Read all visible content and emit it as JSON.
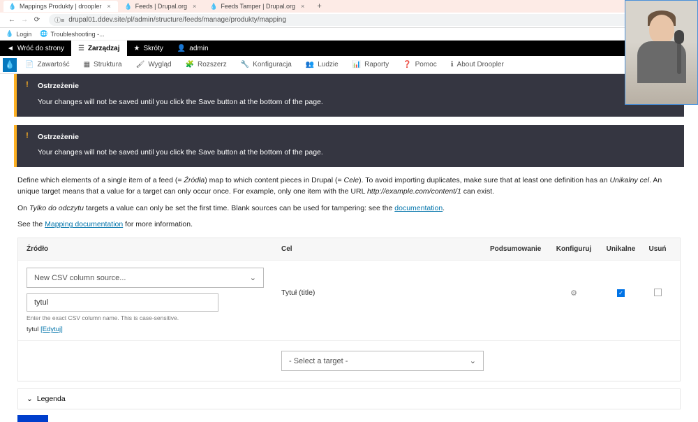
{
  "tabs": [
    {
      "label": "Mappings Produkty | droopler",
      "active": true,
      "favicon": "drupal"
    },
    {
      "label": "Feeds | Drupal.org",
      "active": false,
      "favicon": "drupal"
    },
    {
      "label": "Feeds Tamper | Drupal.org",
      "active": false,
      "favicon": "drupal"
    }
  ],
  "url": "drupal01.ddev.site/pl/admin/structure/feeds/manage/produkty/mapping",
  "bookmarks": [
    {
      "label": "Login"
    },
    {
      "label": "Troubleshooting -..."
    }
  ],
  "black_toolbar": {
    "back": "Wróć do strony",
    "manage": "Zarządzaj",
    "shortcuts": "Skróty",
    "admin": "admin"
  },
  "sub_toolbar": {
    "items": [
      "Zawartość",
      "Struktura",
      "Wygląd",
      "Rozszerz",
      "Konfiguracja",
      "Ludzie",
      "Raporty",
      "Pomoc",
      "About Droopler"
    ]
  },
  "warning": {
    "title": "Ostrzeżenie",
    "message": "Your changes will not be saved until you click the Save button at the bottom of the page."
  },
  "description": {
    "line1_prefix": "Define which elements of a single item of a feed (= ",
    "src_em": "Źródła",
    "line1_mid": ") map to which content pieces in Drupal (= ",
    "tgt_em": "Cele",
    "line1_mid2": "). To avoid importing duplicates, make sure that at least one definition has an ",
    "unique_em": "Unikalny cel",
    "line1_suffix": ". An unique target means that a value for a target can only occur once. For example, only one item with the URL ",
    "url_em": "http://example.com/content/1",
    "line1_end": " can exist.",
    "line2_prefix": "On ",
    "readonly_em": "Tylko do odczytu",
    "line2_mid": " targets a value can only be set the first time. Blank sources can be used for tampering: see the ",
    "doc_link": "documentation",
    "line2_end": ".",
    "line3_prefix": "See the ",
    "mapping_link": "Mapping documentation",
    "line3_suffix": " for more information."
  },
  "table": {
    "headers": {
      "source": "Źródło",
      "target": "Cel",
      "summary": "Podsumowanie",
      "configure": "Konfiguruj",
      "unique": "Unikalne",
      "delete": "Usuń"
    },
    "row": {
      "select_placeholder": "New CSV column source...",
      "input_value": "tytul",
      "helper": "Enter the exact CSV column name. This is case-sensitive.",
      "existing_label": "tytul",
      "edit_link": "[Edytuj]",
      "target_label": "Tytuł (title)"
    },
    "new_target_placeholder": "- Select a target -"
  },
  "legend": "Legenda"
}
